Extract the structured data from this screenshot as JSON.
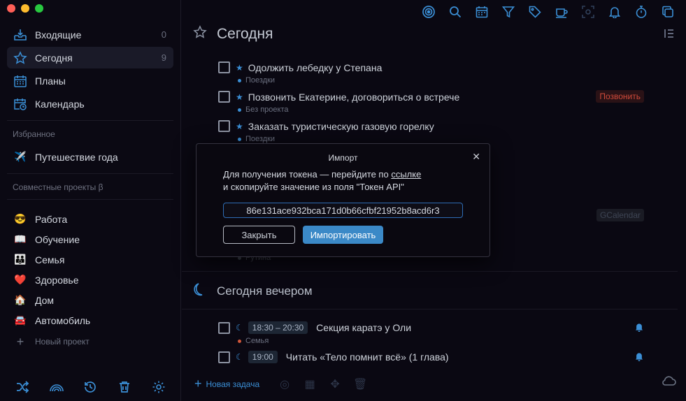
{
  "sidebar": {
    "nav": [
      {
        "label": "Входящие",
        "count": "0",
        "icon": "inbox-icon"
      },
      {
        "label": "Сегодня",
        "count": "9",
        "icon": "star-icon"
      },
      {
        "label": "Планы",
        "count": "",
        "icon": "plans-calendar-icon"
      },
      {
        "label": "Календарь",
        "count": "",
        "icon": "calendar-clock-icon"
      }
    ],
    "favorites_title": "Избранное",
    "favorites": [
      {
        "label": "Путешествие года",
        "icon": "✈️"
      }
    ],
    "shared_title": "Совместные проекты β",
    "projects": [
      {
        "label": "Работа",
        "icon": "😎"
      },
      {
        "label": "Обучение",
        "icon": "📖"
      },
      {
        "label": "Семья",
        "icon": "👪"
      },
      {
        "label": "Здоровье",
        "icon": "❤️"
      },
      {
        "label": "Дом",
        "icon": "🏠"
      },
      {
        "label": "Автомобиль",
        "icon": "🚘"
      }
    ],
    "new_project": "Новый проект"
  },
  "main": {
    "title": "Сегодня",
    "tasks": [
      {
        "title": "Одолжить лебедку у Степана",
        "project": "Поездки",
        "dot_color": "#3b8fd6"
      },
      {
        "title": "Позвонить Екатерине, договориться о встрече",
        "project": "Без проекта",
        "dot_color": "#3b8fd6",
        "tag": "Позвонить"
      },
      {
        "title": "Заказать туристическую газовую горелку",
        "project": "Поездки",
        "dot_color": "#3b8fd6"
      }
    ],
    "hidden_tag": "GCalendar",
    "hidden_project": "Рутина",
    "evening_title": "Сегодня вечером",
    "evening_tasks": [
      {
        "time": "18:30 – 20:30",
        "title": "Секция каратэ у Оли",
        "project": "Семья",
        "dot_color": "#d0563a"
      },
      {
        "time": "19:00",
        "title": "Читать «Тело помнит всё» (1 глава)",
        "project": ""
      }
    ],
    "new_task": "Новая задача"
  },
  "dialog": {
    "title": "Импорт",
    "message_line1": "Для получения токена — перейдите по ",
    "message_link": "ссылке",
    "message_line2": "и скопируйте значение из поля \"Токен API\"",
    "token_value": "86e131ace932bca171d0b66cfbf21952b8acd6r3",
    "close_label": "Закрыть",
    "import_label": "Импортировать"
  },
  "colors": {
    "accent": "#3b8fd6",
    "background": "#0a0812",
    "tag_red": "#d04a3a"
  }
}
